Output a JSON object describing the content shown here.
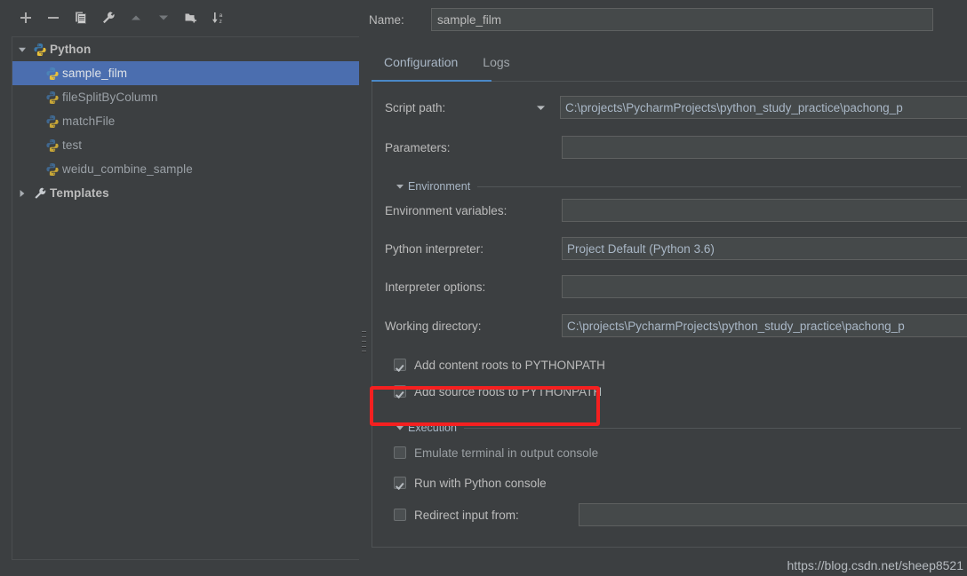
{
  "theme": {
    "bg": "#3c3f41",
    "field_bg": "#45494a",
    "text": "#bbbbbb",
    "muted_text": "#a9b7c6",
    "selection_blue": "#4b6eaf",
    "accent_blue": "#4a88c7",
    "annotation_red": "#f42020",
    "python_blue": "#3c78a8",
    "python_yellow": "#e8c03a"
  },
  "left_panel": {
    "toolbar": {
      "buttons": [
        {
          "name": "add-configuration-button",
          "icon": "plus-icon",
          "label": "Add New Configuration",
          "enabled": true
        },
        {
          "name": "remove-configuration-button",
          "icon": "minus-icon",
          "label": "Remove Configuration",
          "enabled": true
        },
        {
          "name": "copy-configuration-button",
          "icon": "copy-icon",
          "label": "Copy Configuration",
          "enabled": true
        },
        {
          "name": "edit-defaults-button",
          "icon": "wrench-icon",
          "label": "Edit Defaults",
          "enabled": true
        },
        {
          "name": "move-up-button",
          "icon": "arrow-up-icon",
          "label": "Move Up",
          "enabled": false
        },
        {
          "name": "move-down-button",
          "icon": "arrow-down-icon",
          "label": "Move Down",
          "enabled": false
        },
        {
          "name": "new-folder-button",
          "icon": "folder-add-icon",
          "label": "Create New Folder",
          "enabled": true
        },
        {
          "name": "sort-alphabetically-button",
          "icon": "sort-az-icon",
          "label": "Sort Configurations",
          "enabled": true
        }
      ]
    },
    "tree": [
      {
        "label": "Python",
        "icon": "python-icon",
        "kind": "group",
        "expanded": true,
        "selected": false
      },
      {
        "label": "sample_film",
        "icon": "python-file-icon",
        "kind": "child",
        "selected": true
      },
      {
        "label": "fileSplitByColumn",
        "icon": "python-file-icon",
        "kind": "child",
        "selected": false
      },
      {
        "label": "matchFile",
        "icon": "python-file-icon",
        "kind": "child",
        "selected": false
      },
      {
        "label": "test",
        "icon": "python-file-icon",
        "kind": "child",
        "selected": false
      },
      {
        "label": "weidu_combine_sample",
        "icon": "python-file-icon",
        "kind": "child",
        "selected": false
      },
      {
        "label": "Templates",
        "icon": "wrench-icon",
        "kind": "group",
        "expanded": false,
        "selected": false
      }
    ]
  },
  "right_panel": {
    "name_field": {
      "label": "Name:",
      "value": "sample_film",
      "placeholder": ""
    },
    "tabs": [
      {
        "label": "Configuration",
        "active": true
      },
      {
        "label": "Logs",
        "active": false
      }
    ],
    "fields": {
      "script_path": {
        "label": "Script path:",
        "value": "C:\\projects\\PycharmProjects\\python_study_practice\\pachong_p",
        "has_dropdown": true
      },
      "parameters": {
        "label": "Parameters:",
        "value": "",
        "placeholder": ""
      },
      "environment_variables": {
        "label": "Environment variables:",
        "value": "",
        "placeholder": ""
      },
      "python_interpreter": {
        "label": "Python interpreter:",
        "value": "Project Default (Python 3.6)"
      },
      "interpreter_options": {
        "label": "Interpreter options:",
        "value": "",
        "placeholder": ""
      },
      "working_directory": {
        "label": "Working directory:",
        "value": "C:\\projects\\PycharmProjects\\python_study_practice\\pachong_p"
      },
      "redirect_input": {
        "label": "Redirect input from:",
        "value": "",
        "checked": false
      }
    },
    "sections": [
      {
        "name": "environment",
        "title": "Environment",
        "expanded": true
      },
      {
        "name": "execution",
        "title": "Execution",
        "expanded": true
      }
    ],
    "checkboxes": {
      "add_content_roots": {
        "label": "Add content roots to PYTHONPATH",
        "checked": true
      },
      "add_source_roots": {
        "label": "Add source roots to PYTHONPATH",
        "checked": true
      },
      "emulate_terminal": {
        "label": "Emulate terminal in output console",
        "checked": false
      },
      "run_with_python_console": {
        "label": "Run with Python console",
        "checked": true
      }
    }
  },
  "annotation": {
    "highlight_target": "run-with-python-console-checkbox",
    "color": "#f42020"
  },
  "watermark": {
    "text": "https://blog.csdn.net/sheep8521"
  }
}
